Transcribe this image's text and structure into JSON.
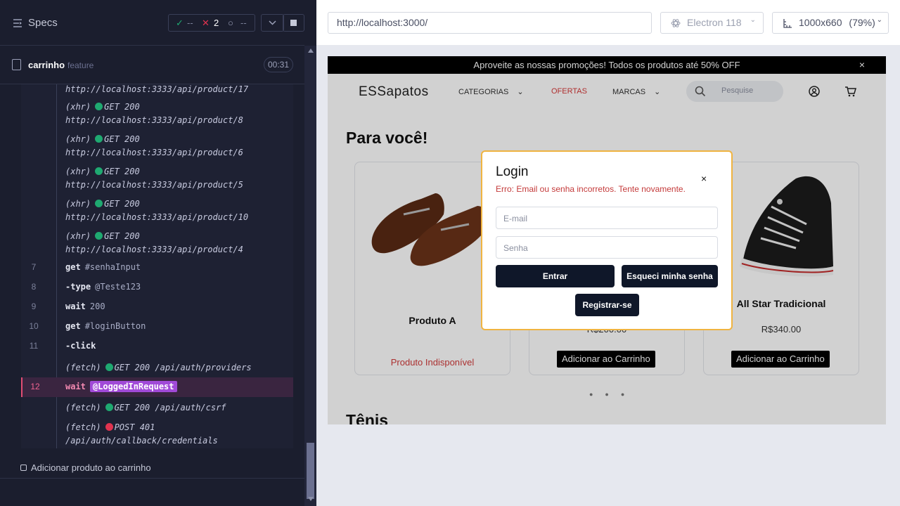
{
  "runner": {
    "specs_label": "Specs",
    "passed": "--",
    "failed": "2",
    "pending": "--",
    "spec_name": "carrinho",
    "spec_tag": "feature",
    "duration": "00:31"
  },
  "log": {
    "rows": [
      {
        "url": "http://localhost:3333/api/product/17"
      },
      {
        "kind": "(xhr)",
        "method": "GET 200",
        "url": "http://localhost:3333/api/product/8"
      },
      {
        "kind": "(xhr)",
        "method": "GET 200",
        "url": "http://localhost:3333/api/product/6"
      },
      {
        "kind": "(xhr)",
        "method": "GET 200",
        "url": "http://localhost:3333/api/product/5"
      },
      {
        "kind": "(xhr)",
        "method": "GET 200",
        "url": "http://localhost:3333/api/product/10"
      },
      {
        "kind": "(xhr)",
        "method": "GET 200",
        "url": "http://localhost:3333/api/product/4"
      }
    ],
    "cmds": [
      {
        "num": "7",
        "cmd": "get",
        "arg": "#senhaInput"
      },
      {
        "num": "8",
        "cmd": "-type",
        "arg": "@Teste123"
      },
      {
        "num": "9",
        "cmd": "wait",
        "arg": "200"
      },
      {
        "num": "10",
        "cmd": "get",
        "arg": "#loginButton"
      },
      {
        "num": "11",
        "cmd": "-click",
        "arg": ""
      }
    ],
    "fetch1": {
      "kind": "(fetch)",
      "method": "GET 200",
      "url": "/api/auth/providers"
    },
    "active": {
      "num": "12",
      "cmd": "wait",
      "alias": "@LoggedInRequest"
    },
    "fetch2": {
      "kind": "(fetch)",
      "method": "GET 200",
      "url": "/api/auth/csrf"
    },
    "fetch3": {
      "kind": "(fetch)",
      "method": "POST 401",
      "url": "/api/auth/callback/credentials"
    }
  },
  "test_item": "Adicionar produto ao carrinho",
  "browser": {
    "url": "http://localhost:3000/",
    "name": "Electron 118",
    "viewport": "1000x660",
    "zoom": "(79%)"
  },
  "site": {
    "promo": "Aproveite as nossas promoções! Todos os produtos até 50% OFF",
    "promo_close": "×",
    "logo": "ESSapatos",
    "nav": [
      "CATEGORIAS",
      "OFERTAS",
      "MARCAS"
    ],
    "search_placeholder": "Pesquise",
    "section_title": "Para você!",
    "products": [
      {
        "name": "Produto A",
        "status": "Produto Indisponível"
      },
      {
        "name": "",
        "price": "R$200.00",
        "button": "Adicionar ao Carrinho"
      },
      {
        "name": "All Star Tradicional",
        "price": "R$340.00",
        "button": "Adicionar ao Carrinho"
      }
    ],
    "section2": "Tênis"
  },
  "modal": {
    "title": "Login",
    "close": "×",
    "error": "Erro: Email ou senha incorretos. Tente novamente.",
    "email_placeholder": "E-mail",
    "password_placeholder": "Senha",
    "login_button": "Entrar",
    "forgot_button": "Esqueci minha senha",
    "register_button": "Registrar-se"
  },
  "colors": {
    "accent_red": "#e24d74",
    "alias_purple": "#a14ad8",
    "status_green": "#1fa971",
    "status_red": "#e0334f",
    "modal_border": "#f0b441"
  }
}
